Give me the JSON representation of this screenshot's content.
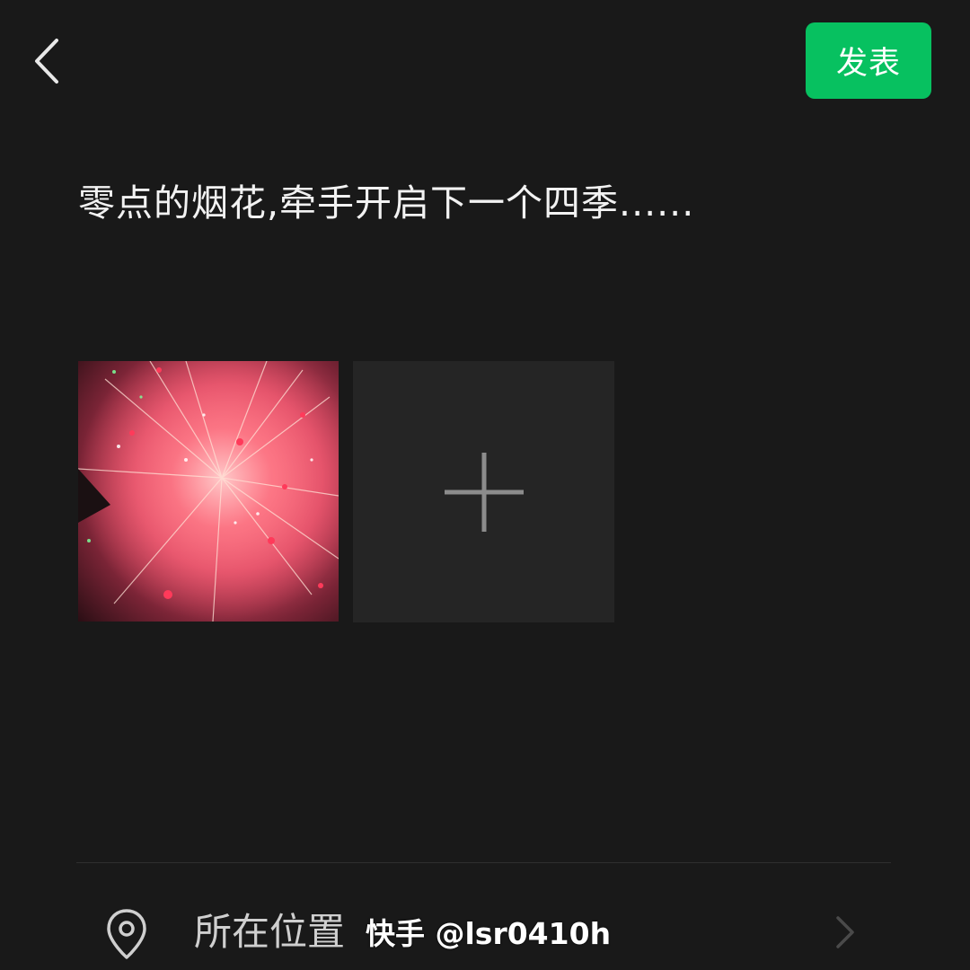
{
  "header": {
    "back_icon": "chevron-left-icon",
    "publish_label": "发表",
    "publish_color": "#07c160"
  },
  "post": {
    "text": "零点的烟花,牵手开启下一个四季......"
  },
  "media": {
    "photo_count": 1,
    "add_icon": "plus-icon"
  },
  "location": {
    "icon": "location-pin-icon",
    "label": "所在位置",
    "chevron_icon": "chevron-right-icon"
  },
  "watermark": {
    "text": "快手 @lsr0410h"
  }
}
